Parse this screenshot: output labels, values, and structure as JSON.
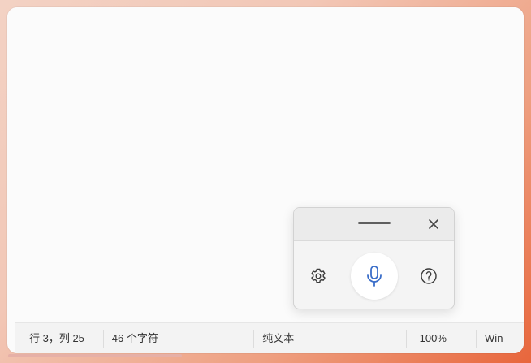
{
  "status_bar": {
    "position": "行 3，列 25",
    "char_count": "46 个字符",
    "format": "纯文本",
    "zoom": "100%",
    "line_ending": "Win"
  },
  "voice_typing": {
    "grip_icon": "drag-handle-icon",
    "close_icon": "close-icon",
    "settings_icon": "gear-icon",
    "mic_icon": "microphone-icon",
    "help_icon": "help-icon",
    "accent_color": "#3b6ec9"
  },
  "colors": {
    "window_bg": "#fbfbfb",
    "status_bar_bg": "#f3f3f3",
    "desktop_accent": "#e8663c"
  }
}
